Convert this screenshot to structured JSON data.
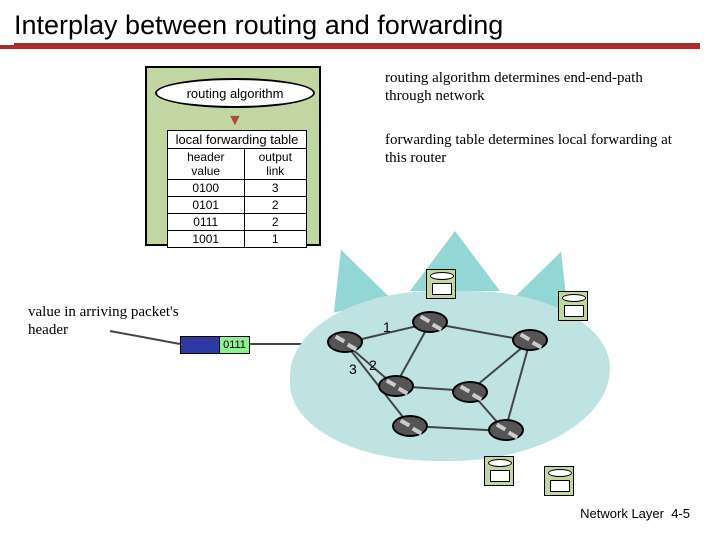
{
  "title": "Interplay between routing and forwarding",
  "router_box": {
    "algorithm_label": "routing algorithm",
    "table_title": "local forwarding table",
    "table_headers": {
      "col1": "header value",
      "col2": "output link"
    },
    "rows": [
      {
        "hv": "0100",
        "ol": "3"
      },
      {
        "hv": "0101",
        "ol": "2"
      },
      {
        "hv": "0111",
        "ol": "2"
      },
      {
        "hv": "1001",
        "ol": "1"
      }
    ]
  },
  "captions": {
    "algo": "routing algorithm determines end-end-path through network",
    "table": "forwarding table determines local forwarding at this router",
    "packet_note": "value in arriving packet's header"
  },
  "packet": {
    "header_value": "0111"
  },
  "port_labels": {
    "one": "1",
    "two": "2",
    "three": "3"
  },
  "footer": {
    "chapter": "Network Layer",
    "page": "4-5"
  }
}
